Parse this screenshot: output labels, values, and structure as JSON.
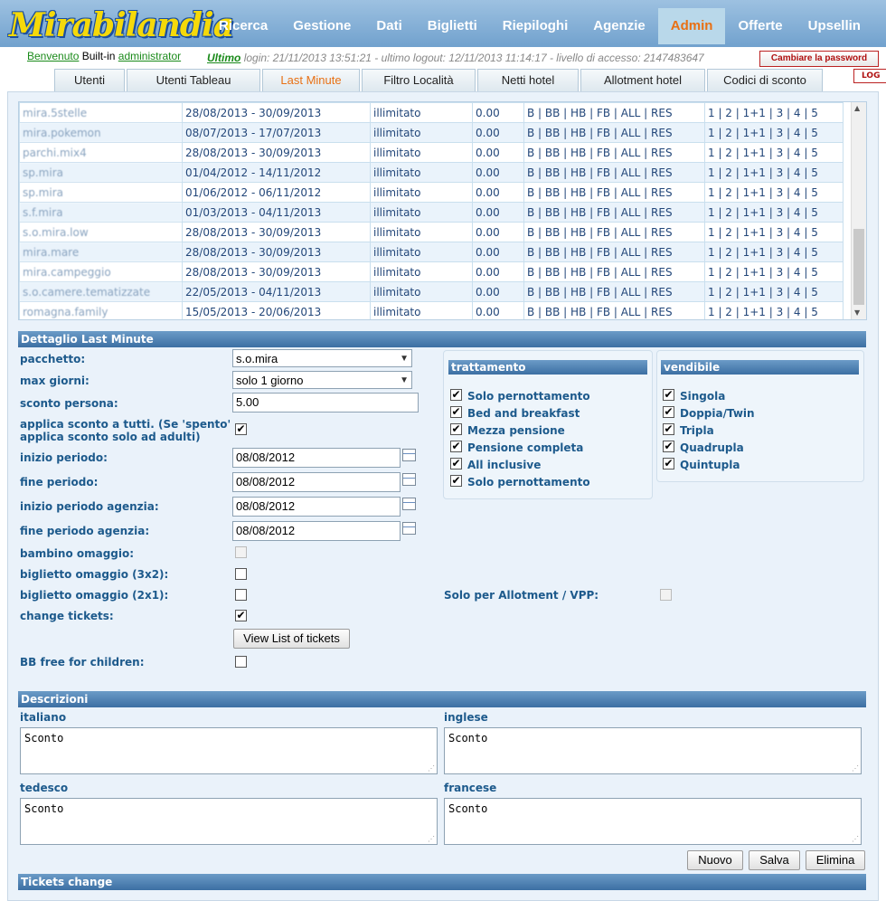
{
  "app": {
    "logo_text": "Mirabilandia",
    "nav": [
      "Ricerca",
      "Gestione",
      "Dati",
      "Biglietti",
      "Riepiloghi",
      "Agenzie",
      "Admin",
      "Offerte",
      "Upsellin"
    ],
    "active_nav": "Admin"
  },
  "userbar": {
    "welcome": "Benvenuto",
    "builtin": "Built-in",
    "user": "administrator",
    "ultimo": "Ultimo",
    "login_info": "login: 21/11/2013 13:51:21 - ultimo logout: 12/11/2013 11:14:17 - livello di accesso: 2147483647",
    "change_password": "Cambiare la password",
    "logout": "LOG"
  },
  "tabs": [
    "Utenti",
    "Utenti Tableau",
    "Last Minute",
    "Filtro Località",
    "Netti hotel",
    "Allotment hotel",
    "Codici di sconto"
  ],
  "active_tab": "Last Minute",
  "grid": {
    "rows": [
      {
        "name": "mira.5stelle",
        "period": "28/08/2013 - 30/09/2013",
        "limit": "illimitato",
        "value": "0.00",
        "treatments": "B | BB | HB | FB | ALL | RES",
        "rooms": "1 | 2 | 1+1 | 3 | 4 | 5"
      },
      {
        "name": "mira.pokemon",
        "period": "08/07/2013 - 17/07/2013",
        "limit": "illimitato",
        "value": "0.00",
        "treatments": "B | BB | HB | FB | ALL | RES",
        "rooms": "1 | 2 | 1+1 | 3 | 4 | 5"
      },
      {
        "name": "parchi.mix4",
        "period": "28/08/2013 - 30/09/2013",
        "limit": "illimitato",
        "value": "0.00",
        "treatments": "B | BB | HB | FB | ALL | RES",
        "rooms": "1 | 2 | 1+1 | 3 | 4 | 5"
      },
      {
        "name": "sp.mira",
        "period": "01/04/2012 - 14/11/2012",
        "limit": "illimitato",
        "value": "0.00",
        "treatments": "B | BB | HB | FB | ALL | RES",
        "rooms": "1 | 2 | 1+1 | 3 | 4 | 5"
      },
      {
        "name": "sp.mira",
        "period": "01/06/2012 - 06/11/2012",
        "limit": "illimitato",
        "value": "0.00",
        "treatments": "B | BB | HB | FB | ALL | RES",
        "rooms": "1 | 2 | 1+1 | 3 | 4 | 5"
      },
      {
        "name": "s.f.mira",
        "period": "01/03/2013 - 04/11/2013",
        "limit": "illimitato",
        "value": "0.00",
        "treatments": "B | BB | HB | FB | ALL | RES",
        "rooms": "1 | 2 | 1+1 | 3 | 4 | 5"
      },
      {
        "name": "s.o.mira.low",
        "period": "28/08/2013 - 30/09/2013",
        "limit": "illimitato",
        "value": "0.00",
        "treatments": "B | BB | HB | FB | ALL | RES",
        "rooms": "1 | 2 | 1+1 | 3 | 4 | 5"
      },
      {
        "name": "mira.mare",
        "period": "28/08/2013 - 30/09/2013",
        "limit": "illimitato",
        "value": "0.00",
        "treatments": "B | BB | HB | FB | ALL | RES",
        "rooms": "1 | 2 | 1+1 | 3 | 4 | 5"
      },
      {
        "name": "mira.campeggio",
        "period": "28/08/2013 - 30/09/2013",
        "limit": "illimitato",
        "value": "0.00",
        "treatments": "B | BB | HB | FB | ALL | RES",
        "rooms": "1 | 2 | 1+1 | 3 | 4 | 5"
      },
      {
        "name": "s.o.camere.tematizzate",
        "period": "22/05/2013 - 04/11/2013",
        "limit": "illimitato",
        "value": "0.00",
        "treatments": "B | BB | HB | FB | ALL | RES",
        "rooms": "1 | 2 | 1+1 | 3 | 4 | 5"
      },
      {
        "name": "romagna.family",
        "period": "15/05/2013 - 20/06/2013",
        "limit": "illimitato",
        "value": "0.00",
        "treatments": "B | BB | HB | FB | ALL | RES",
        "rooms": "1 | 2 | 1+1 | 3 | 4 | 5"
      }
    ]
  },
  "detail": {
    "title": "Dettaglio Last Minute",
    "pacchetto_label": "pacchetto:",
    "pacchetto_value": "s.o.mira",
    "max_giorni_label": "max giorni:",
    "max_giorni_value": "solo 1 giorno",
    "sconto_label": "sconto persona:",
    "sconto_value": "5.00",
    "applica_label_1": "applica sconto a tutti. (Se 'spento'",
    "applica_label_2": "applica sconto solo ad adulti)",
    "inizio_label": "inizio periodo:",
    "inizio_value": "08/08/2012",
    "fine_label": "fine periodo:",
    "fine_value": "08/08/2012",
    "inizio_ag_label": "inizio periodo agenzia:",
    "inizio_ag_value": "08/08/2012",
    "fine_ag_label": "fine periodo agenzia:",
    "fine_ag_value": "08/08/2012",
    "bambino_label": "bambino omaggio:",
    "biglietto3x2_label": "biglietto omaggio (3x2):",
    "biglietto2x1_label": "biglietto omaggio (2x1):",
    "change_tickets_label": "change tickets:",
    "view_list_button": "View List of tickets",
    "bb_free_label": "BB free for children:",
    "solo_allotment_label": "Solo per Allotment / VPP:",
    "trattamento_title": "trattamento",
    "trattamento": [
      "Solo pernottamento",
      "Bed and breakfast",
      "Mezza pensione",
      "Pensione completa",
      "All inclusive",
      "Solo pernottamento"
    ],
    "vendibile_title": "vendibile",
    "vendibile": [
      "Singola",
      "Doppia/Twin",
      "Tripla",
      "Quadrupla",
      "Quintupla"
    ]
  },
  "descrizioni": {
    "title": "Descrizioni",
    "italiano_label": "italiano",
    "italiano_value": "Sconto",
    "inglese_label": "inglese",
    "inglese_value": "Sconto",
    "tedesco_label": "tedesco",
    "tedesco_value": "Sconto",
    "francese_label": "francese",
    "francese_value": "Sconto"
  },
  "actions": {
    "nuovo": "Nuovo",
    "salva": "Salva",
    "elimina": "Elimina"
  },
  "tickets_change_title": "Tickets change",
  "glyphs": {
    "check": "✔",
    "select_arrow": "▼",
    "scroll_up": "▲",
    "scroll_down": "▼",
    "grip": "⋰"
  }
}
